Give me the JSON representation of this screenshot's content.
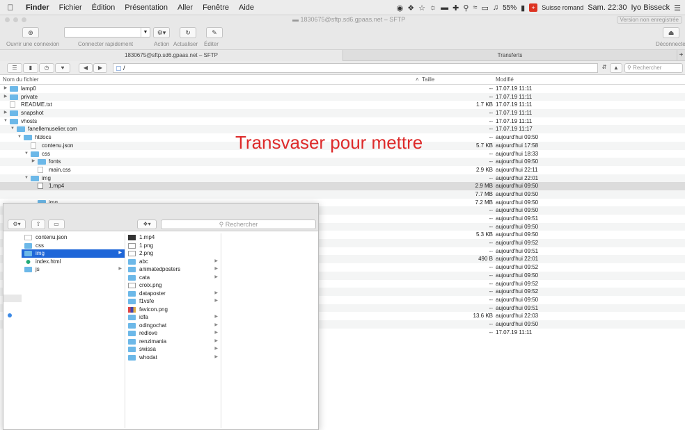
{
  "menubar": {
    "app_name": "Finder",
    "menus": [
      "Fichier",
      "Édition",
      "Présentation",
      "Aller",
      "Fenêtre",
      "Aide"
    ],
    "battery": "55%",
    "input_source": "Suisse romand",
    "clock": "Sam. 22:30",
    "user": "Iyo Bisseck"
  },
  "window": {
    "title": "1830675@sftp.sd6.gpaas.net – SFTP",
    "unregistered": "Version non enregistrée"
  },
  "toolbar": {
    "open_connection": "Ouvrir une connexion",
    "quick_connect": "Connecter rapidement",
    "action": "Action",
    "refresh": "Actualiser",
    "edit": "Éditer",
    "disconnect": "Déconnecter"
  },
  "tabs": {
    "active": "1830675@sftp.sd6.gpaas.net – SFTP",
    "transfers": "Transferts"
  },
  "pathbar": {
    "path": "/",
    "search_placeholder": "Rechercher"
  },
  "columns": {
    "name": "Nom du fichier",
    "size": "Taille",
    "modified": "Modifié"
  },
  "rows": [
    {
      "name": "lamp0",
      "size": "--",
      "modified": "17.07.19 11:11",
      "depth": 0,
      "kind": "folder",
      "disclosure": "closed"
    },
    {
      "name": "private",
      "size": "--",
      "modified": "17.07.19 11:11",
      "depth": 0,
      "kind": "folder",
      "disclosure": "closed"
    },
    {
      "name": "README.txt",
      "size": "1.7 KB",
      "modified": "17.07.19 11:11",
      "depth": 0,
      "kind": "file",
      "disclosure": "none"
    },
    {
      "name": "snapshot",
      "size": "--",
      "modified": "17.07.19 11:11",
      "depth": 0,
      "kind": "folder",
      "disclosure": "closed"
    },
    {
      "name": "vhosts",
      "size": "--",
      "modified": "17.07.19 11:11",
      "depth": 0,
      "kind": "folder",
      "disclosure": "open"
    },
    {
      "name": "fanellemuselier.com",
      "size": "--",
      "modified": "17.07.19 11:17",
      "depth": 1,
      "kind": "folder",
      "disclosure": "open"
    },
    {
      "name": "htdocs",
      "size": "--",
      "modified": "aujourd'hui 09:50",
      "depth": 2,
      "kind": "folder",
      "disclosure": "open"
    },
    {
      "name": "contenu.json",
      "size": "5.7 KB",
      "modified": "aujourd'hui 17:58",
      "depth": 3,
      "kind": "file",
      "disclosure": "none"
    },
    {
      "name": "css",
      "size": "--",
      "modified": "aujourd'hui 18:33",
      "depth": 3,
      "kind": "folder",
      "disclosure": "open"
    },
    {
      "name": "fonts",
      "size": "--",
      "modified": "aujourd'hui 09:50",
      "depth": 4,
      "kind": "folder",
      "disclosure": "closed"
    },
    {
      "name": "main.css",
      "size": "2.9 KB",
      "modified": "aujourd'hui 22:11",
      "depth": 4,
      "kind": "file",
      "disclosure": "none"
    },
    {
      "name": "img",
      "size": "--",
      "modified": "aujourd'hui 22:01",
      "depth": 3,
      "kind": "folder",
      "disclosure": "open"
    },
    {
      "name": "1.mp4",
      "size": "2.9 MB",
      "modified": "aujourd'hui 09:50",
      "depth": 4,
      "kind": "media",
      "disclosure": "none",
      "selected": true
    },
    {
      "name": "",
      "size": "7.7 MB",
      "modified": "aujourd'hui 09:50",
      "depth": 4,
      "kind": "none",
      "disclosure": "none"
    },
    {
      "name": "img",
      "size": "7.2 MB",
      "modified": "aujourd'hui 09:50",
      "depth": 4,
      "kind": "folder",
      "disclosure": "none"
    },
    {
      "name": "",
      "size": "--",
      "modified": "aujourd'hui 09:50",
      "depth": 4,
      "kind": "none",
      "disclosure": "none"
    },
    {
      "name": "",
      "size": "--",
      "modified": "aujourd'hui 09:51",
      "depth": 4,
      "kind": "none",
      "disclosure": "none"
    },
    {
      "name": "",
      "size": "--",
      "modified": "aujourd'hui 09:50",
      "depth": 4,
      "kind": "none",
      "disclosure": "none"
    },
    {
      "name": "",
      "size": "5.3 KB",
      "modified": "aujourd'hui 09:50",
      "depth": 4,
      "kind": "none",
      "disclosure": "none"
    },
    {
      "name": "",
      "size": "--",
      "modified": "aujourd'hui 09:52",
      "depth": 4,
      "kind": "none",
      "disclosure": "none"
    },
    {
      "name": "",
      "size": "--",
      "modified": "aujourd'hui 09:51",
      "depth": 4,
      "kind": "none",
      "disclosure": "none"
    },
    {
      "name": "",
      "size": "490 B",
      "modified": "aujourd'hui 22:01",
      "depth": 4,
      "kind": "none",
      "disclosure": "none"
    },
    {
      "name": "",
      "size": "--",
      "modified": "aujourd'hui 09:52",
      "depth": 4,
      "kind": "none",
      "disclosure": "none"
    },
    {
      "name": "",
      "size": "--",
      "modified": "aujourd'hui 09:50",
      "depth": 4,
      "kind": "none",
      "disclosure": "none"
    },
    {
      "name": "",
      "size": "--",
      "modified": "aujourd'hui 09:52",
      "depth": 4,
      "kind": "none",
      "disclosure": "none"
    },
    {
      "name": "",
      "size": "--",
      "modified": "aujourd'hui 09:52",
      "depth": 4,
      "kind": "none",
      "disclosure": "none"
    },
    {
      "name": "",
      "size": "--",
      "modified": "aujourd'hui 09:50",
      "depth": 4,
      "kind": "none",
      "disclosure": "none"
    },
    {
      "name": "",
      "size": "--",
      "modified": "aujourd'hui 09:51",
      "depth": 4,
      "kind": "none",
      "disclosure": "none"
    },
    {
      "name": "",
      "size": "13.6 KB",
      "modified": "aujourd'hui 22:03",
      "depth": 4,
      "kind": "none",
      "disclosure": "none"
    },
    {
      "name": "",
      "size": "--",
      "modified": "aujourd'hui 09:50",
      "depth": 4,
      "kind": "none",
      "disclosure": "none"
    },
    {
      "name": "",
      "size": "--",
      "modified": "17.07.19 11:11",
      "depth": 4,
      "kind": "none",
      "disclosure": "none"
    }
  ],
  "annotation": "Transvaser pour mettre",
  "finder": {
    "search_placeholder": "Rechercher",
    "column1": [
      {
        "name": "contenu.json",
        "kind": "file"
      },
      {
        "name": "css",
        "kind": "folder"
      },
      {
        "name": "img",
        "kind": "folder",
        "selected": true,
        "chevron": true
      },
      {
        "name": "index.html",
        "kind": "html"
      },
      {
        "name": "js",
        "kind": "folder",
        "chevron": true
      }
    ],
    "column2": [
      {
        "name": "1.mp4",
        "kind": "video"
      },
      {
        "name": "1.png",
        "kind": "png"
      },
      {
        "name": "2.png",
        "kind": "png"
      },
      {
        "name": "abc",
        "kind": "folder",
        "chevron": true
      },
      {
        "name": "animatedposters",
        "kind": "folder",
        "chevron": true
      },
      {
        "name": "cata",
        "kind": "folder",
        "chevron": true
      },
      {
        "name": "croix.png",
        "kind": "xmark"
      },
      {
        "name": "dataposter",
        "kind": "folder",
        "chevron": true
      },
      {
        "name": "f1vsfe",
        "kind": "folder",
        "chevron": true
      },
      {
        "name": "favicon.png",
        "kind": "fav"
      },
      {
        "name": "idfa",
        "kind": "folder",
        "chevron": true
      },
      {
        "name": "odingochat",
        "kind": "folder",
        "chevron": true
      },
      {
        "name": "redlove",
        "kind": "folder",
        "chevron": true
      },
      {
        "name": "renzimania",
        "kind": "folder",
        "chevron": true
      },
      {
        "name": "swissa",
        "kind": "folder",
        "chevron": true
      },
      {
        "name": "whodat",
        "kind": "folder",
        "chevron": true
      }
    ]
  },
  "colors": {
    "annotation": "#dd2a2a",
    "selection": "#1e66d8",
    "folder": "#6cb8e8"
  }
}
